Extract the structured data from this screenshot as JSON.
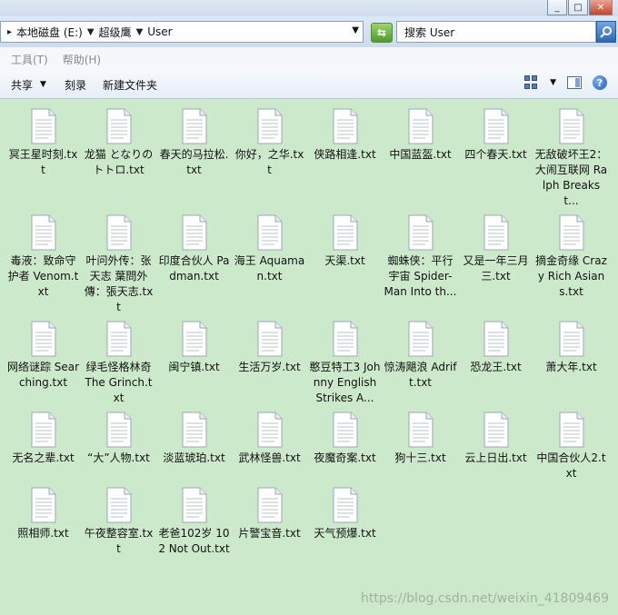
{
  "window": {
    "min_label": "_",
    "max_label": "□",
    "close_label": "✕"
  },
  "address": {
    "crumbs": [
      "本地磁盘 (E:)",
      "超级鹰",
      "User"
    ],
    "lead_sep": "▸"
  },
  "search": {
    "value": "搜索 User"
  },
  "menu": {
    "tools": "工具(T)",
    "help": "帮助(H)"
  },
  "commands": {
    "share": "共享",
    "burn": "刻录",
    "new_folder": "新建文件夹"
  },
  "files": [
    "冥王星时刻.txt",
    "龙猫 となりのトトロ.txt",
    "春天的马拉松.txt",
    "你好，之华.txt",
    "侠路相逢.txt",
    "中国蓝盔.txt",
    "四个春天.txt",
    "无敌破坏王2：大闹互联网 Ralph Breaks t...",
    "毒液：致命守护者 Venom.txt",
    "叶问外传：张天志 葉問外傳：張天志.txt",
    "印度合伙人 Padman.txt",
    "海王 Aquaman.txt",
    "天渠.txt",
    "蜘蛛侠：平行宇宙 Spider-Man Into th...",
    "又是一年三月三.txt",
    "摘金奇缘 Crazy Rich Asians.txt",
    "网络谜踪 Searching.txt",
    "绿毛怪格林奇 The Grinch.txt",
    "闽宁镇.txt",
    "生活万岁.txt",
    "憨豆特工3 Johnny English Strikes A...",
    "惊涛飓浪 Adrift.txt",
    "恐龙王.txt",
    "萧大年.txt",
    "无名之辈.txt",
    "“大”人物.txt",
    "淡蓝琥珀.txt",
    "武林怪兽.txt",
    "夜魔奇案.txt",
    "狗十三.txt",
    "云上日出.txt",
    "中国合伙人2.txt",
    "照相师.txt",
    "午夜整容室.txt",
    "老爸102岁 102 Not Out.txt",
    "片警宝音.txt",
    "天气预爆.txt"
  ],
  "watermark": "https://blog.csdn.net/weixin_41809469",
  "colors": {
    "content_bg": "#cde9cb",
    "accent": "#2b66b8"
  }
}
